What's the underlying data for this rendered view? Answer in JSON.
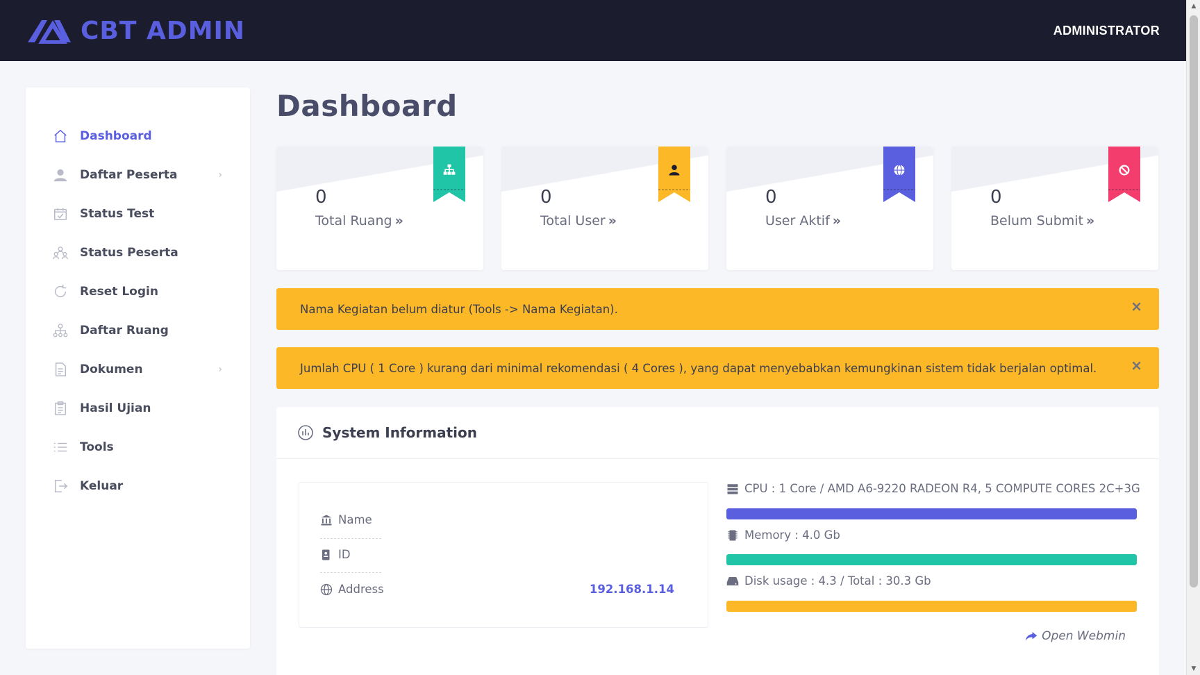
{
  "header": {
    "brand": "CBT ADMIN",
    "user": "ADMINISTRATOR"
  },
  "colors": {
    "brand": "#5a5fe0",
    "topbar": "#1b1c2e",
    "teal": "#20c5a8",
    "amber": "#fdb827",
    "indigo": "#5a5fe0",
    "pink": "#f23d6d"
  },
  "sidebar": {
    "items": [
      {
        "label": "Dashboard",
        "icon": "home-icon",
        "active": true
      },
      {
        "label": "Daftar Peserta",
        "icon": "user-icon",
        "chevron": true
      },
      {
        "label": "Status Test",
        "icon": "calendar-check-icon"
      },
      {
        "label": "Status Peserta",
        "icon": "users-icon"
      },
      {
        "label": "Reset Login",
        "icon": "refresh-icon"
      },
      {
        "label": "Daftar Ruang",
        "icon": "sitemap-icon"
      },
      {
        "label": "Dokumen",
        "icon": "document-icon",
        "chevron": true
      },
      {
        "label": "Hasil Ujian",
        "icon": "clipboard-icon"
      },
      {
        "label": "Tools",
        "icon": "list-icon"
      },
      {
        "label": "Keluar",
        "icon": "logout-icon"
      }
    ]
  },
  "main": {
    "title": "Dashboard",
    "stats": [
      {
        "value": "0",
        "label": "Total Ruang",
        "icon": "sitemap-icon",
        "color": "#20c5a8"
      },
      {
        "value": "0",
        "label": "Total User",
        "icon": "user-icon",
        "color": "#fdb827"
      },
      {
        "value": "0",
        "label": "User Aktif",
        "icon": "globe-icon",
        "color": "#5a5fe0"
      },
      {
        "value": "0",
        "label": "Belum Submit",
        "icon": "ban-icon",
        "color": "#f23d6d"
      }
    ],
    "alerts": [
      {
        "text": "Nama Kegiatan belum diatur (Tools -> Nama Kegiatan)."
      },
      {
        "text": "Jumlah CPU ( 1 Core ) kurang dari minimal rekomendasi ( 4 Cores ), yang dapat menyebabkan kemungkinan sistem tidak berjalan optimal."
      }
    ],
    "close_symbol": "×"
  },
  "system": {
    "title": "System Information",
    "info": {
      "name_label": "Name",
      "id_label": "ID",
      "address_label": "Address",
      "address_value": "192.168.1.14"
    },
    "resources": [
      {
        "label": "CPU : 1 Core / AMD A6-9220 RADEON R4, 5 COMPUTE CORES 2C+3G",
        "icon": "server-icon",
        "fill": 1.0,
        "color": "#5a5fe0"
      },
      {
        "label": "Memory : 4.0 Gb",
        "icon": "memory-icon",
        "fill": 1.0,
        "color": "#20c5a8"
      },
      {
        "label": "Disk usage : 4.3 / Total : 30.3 Gb",
        "icon": "hdd-icon",
        "fill": 1.0,
        "color": "#fdb827"
      }
    ],
    "webmin_label": "Open Webmin"
  }
}
